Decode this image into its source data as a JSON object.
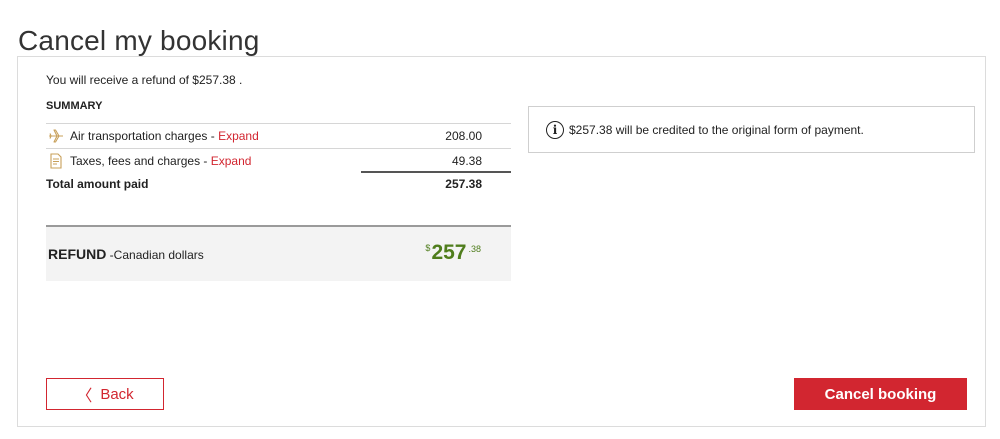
{
  "page": {
    "title": "Cancel my booking"
  },
  "refund_intro": "You will receive a refund of $257.38 .",
  "summary": {
    "title": "SUMMARY",
    "items": [
      {
        "label": "Air transportation charges",
        "separator": " - ",
        "expand": "Expand",
        "amount": "208.00",
        "icon": "airplane-icon"
      },
      {
        "label": "Taxes, fees and charges",
        "separator": " - ",
        "expand": "Expand",
        "amount": "49.38",
        "icon": "receipt-icon"
      }
    ],
    "total_label": "Total amount paid",
    "total_amount": "257.38"
  },
  "refund": {
    "label": "REFUND",
    "sub": " -Canadian dollars",
    "currency_symbol": "$",
    "whole": "257",
    "cents": ".38"
  },
  "info": {
    "icon": "info-icon",
    "glyph": "i",
    "text": "$257.38 will be credited to the original form of payment."
  },
  "buttons": {
    "back_chevron": "〈",
    "back": "Back",
    "cancel": "Cancel booking"
  },
  "colors": {
    "accent_red": "#d22630",
    "refund_green": "#4f7d1c",
    "icon_tan": "#c8a05a"
  }
}
